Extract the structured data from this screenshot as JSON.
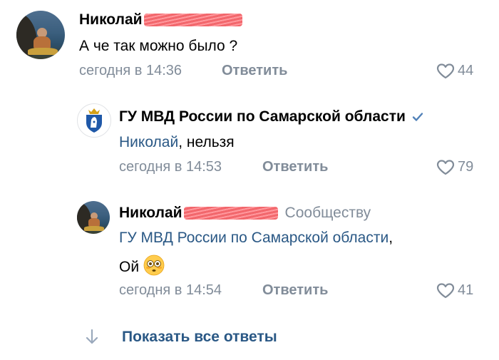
{
  "comments": [
    {
      "author": "Николай",
      "text": "А че так можно было ?",
      "time": "сегодня в 14:36",
      "reply_label": "Ответить",
      "likes": "44"
    },
    {
      "author": "ГУ МВД России по Самарской области",
      "verified": true,
      "mention": "Николай",
      "text": ", нельзя",
      "time": "сегодня в 14:53",
      "reply_label": "Ответить",
      "likes": "79"
    },
    {
      "author": "Николай",
      "target": "Сообществу",
      "mention": "ГУ МВД России по Самарской области",
      "mention_suffix": ",",
      "text": "Ой",
      "emoji": "flushed-face",
      "time": "сегодня в 14:54",
      "reply_label": "Ответить",
      "likes": "41"
    }
  ],
  "show_all_replies": "Показать все ответы",
  "colors": {
    "link": "#2a5885",
    "meta": "#818c99",
    "verified": "#5181b8",
    "censor": "#f0565c"
  }
}
